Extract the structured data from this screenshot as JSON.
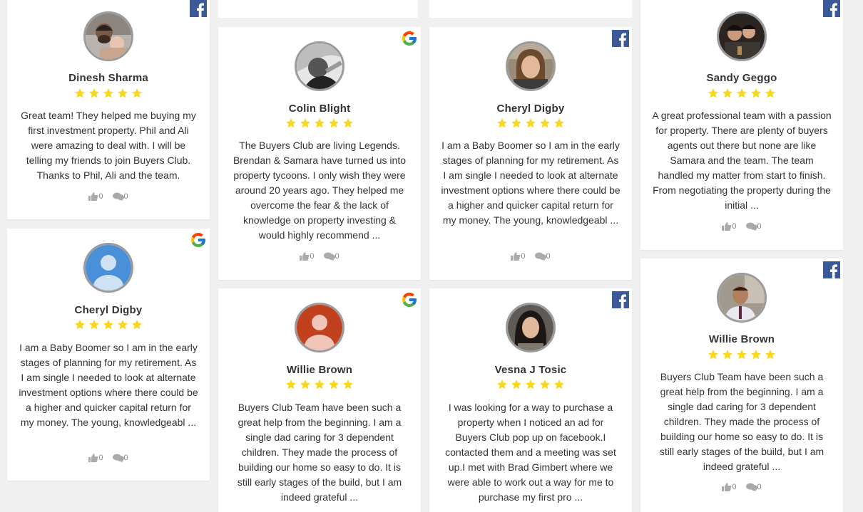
{
  "colors": {
    "facebook": "#3b5998",
    "star": "#f9d71c",
    "page_bg": "#f0f0f0"
  },
  "reviews": [
    {
      "name": "Dinesh Sharma",
      "rating": 5,
      "source": "facebook",
      "avatar": "photo-man-with-baby",
      "text": "Great team! They helped me buying my first investment property. Phil and Ali were amazing to deal with. I will be telling my friends to join Buyers Club. Thanks to Phil, Ali and the team.",
      "likes": "0",
      "comments": "0"
    },
    {
      "name": "Cheryl Digby",
      "rating": 5,
      "source": "google",
      "avatar": "default-user-avatar",
      "text": "I am a Baby Boomer so I am in the early stages of planning for my retirement. As I am single I needed to look at alternate investment options where there could be a higher and quicker capital return for my money. The young, knowledgeabl ...",
      "likes": "0",
      "comments": "0"
    },
    {
      "name": "Colin Blight",
      "rating": 5,
      "source": "google",
      "avatar": "photo-grayscale-man",
      "text": "The Buyers Club are living Legends. Brendan & Samara have turned us into property tycoons. I only wish they were around 20 years ago. They helped me overcome the fear & the lack of knowledge on property investing & would highly recommend ...",
      "likes": "0",
      "comments": "0"
    },
    {
      "name": "Willie Brown",
      "rating": 5,
      "source": "google",
      "avatar": "letter-avatar-red",
      "text": "Buyers Club Team have been such a great help from the beginning. I am a single dad caring for 3 dependent children. They made the process of building our home so easy to do. It is still early stages of the build, but I am indeed grateful ...",
      "likes": "0",
      "comments": "0"
    },
    {
      "name": "Cheryl Digby",
      "rating": 5,
      "source": "facebook",
      "avatar": "photo-woman",
      "text": "I am a Baby Boomer so I am in the early stages of planning for my retirement. As I am single I needed to look at alternate investment options where there could be a higher and quicker capital return for my money. The young, knowledgeabl ...",
      "likes": "0",
      "comments": "0"
    },
    {
      "name": "Vesna J Tosic",
      "rating": 5,
      "source": "facebook",
      "avatar": "photo-woman-dark-hair",
      "text": "I was looking for a way to purchase a property when I noticed an ad for Buyers Club pop up on facebook.I contacted them and a meeting was set up.I met with Brad Gimbert where we were able to work out a way for me to purchase my first pro ...",
      "likes": "0",
      "comments": "0"
    },
    {
      "name": "Sandy Geggo",
      "rating": 5,
      "source": "facebook",
      "avatar": "photo-couple",
      "text": "A great professional team with a passion for property. There are plenty of buyers agents out there but none are like Samara and the team. The team handled my matter from start to finish. From negotiating the property during the initial ...",
      "likes": "0",
      "comments": "0"
    },
    {
      "name": "Willie Brown",
      "rating": 5,
      "source": "facebook",
      "avatar": "photo-man-shirt",
      "text": "Buyers Club Team have been such a great help from the beginning. I am a single dad caring for 3 dependent children. They made the process of building our home so easy to do. It is still early stages of the build, but I am indeed grateful ...",
      "likes": "0",
      "comments": "0"
    }
  ]
}
